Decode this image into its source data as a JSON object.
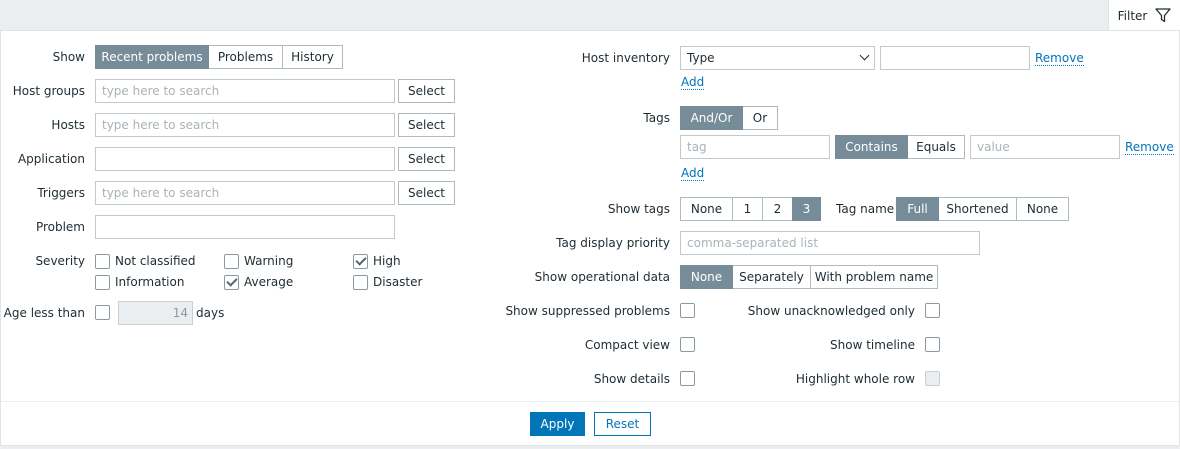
{
  "filter_tab": {
    "label": "Filter",
    "icon": "funnel-icon"
  },
  "left": {
    "show": {
      "label": "Show",
      "options": [
        "Recent problems",
        "Problems",
        "History"
      ],
      "selected": "Recent problems"
    },
    "host_groups": {
      "label": "Host groups",
      "placeholder": "type here to search",
      "button": "Select"
    },
    "hosts": {
      "label": "Hosts",
      "placeholder": "type here to search",
      "button": "Select"
    },
    "application": {
      "label": "Application",
      "value": "",
      "button": "Select"
    },
    "triggers": {
      "label": "Triggers",
      "placeholder": "type here to search",
      "button": "Select"
    },
    "problem": {
      "label": "Problem",
      "value": ""
    },
    "severity": {
      "label": "Severity",
      "items": [
        {
          "label": "Not classified",
          "checked": false
        },
        {
          "label": "Warning",
          "checked": false
        },
        {
          "label": "High",
          "checked": true
        },
        {
          "label": "Information",
          "checked": false
        },
        {
          "label": "Average",
          "checked": true
        },
        {
          "label": "Disaster",
          "checked": false
        }
      ]
    },
    "age": {
      "label": "Age less than",
      "checked": false,
      "value": "14",
      "unit": "days"
    }
  },
  "right": {
    "host_inventory": {
      "label": "Host inventory",
      "select_value": "Type",
      "value": "",
      "remove": "Remove",
      "add": "Add"
    },
    "tags": {
      "label": "Tags",
      "operator_options": [
        "And/Or",
        "Or"
      ],
      "operator_selected": "And/Or",
      "tag_placeholder": "tag",
      "match_options": [
        "Contains",
        "Equals"
      ],
      "match_selected": "Contains",
      "value_placeholder": "value",
      "remove": "Remove",
      "add": "Add"
    },
    "show_tags": {
      "label": "Show tags",
      "options": [
        "None",
        "1",
        "2",
        "3"
      ],
      "selected": "3"
    },
    "tag_name": {
      "label": "Tag name",
      "options": [
        "Full",
        "Shortened",
        "None"
      ],
      "selected": "Full"
    },
    "tag_display_priority": {
      "label": "Tag display priority",
      "placeholder": "comma-separated list"
    },
    "show_operational_data": {
      "label": "Show operational data",
      "options": [
        "None",
        "Separately",
        "With problem name"
      ],
      "selected": "None"
    },
    "show_suppressed": {
      "label": "Show suppressed problems",
      "checked": false
    },
    "show_unacknowledged": {
      "label": "Show unacknowledged only",
      "checked": false
    },
    "compact_view": {
      "label": "Compact view",
      "checked": false
    },
    "show_timeline": {
      "label": "Show timeline",
      "checked": false
    },
    "show_details": {
      "label": "Show details",
      "checked": false
    },
    "highlight_whole_row": {
      "label": "Highlight whole row",
      "checked": false,
      "disabled": true
    }
  },
  "actions": {
    "apply": "Apply",
    "reset": "Reset"
  },
  "colors": {
    "accent": "#0275b8",
    "segment_active": "#768d99",
    "border": "#acbbc2"
  }
}
